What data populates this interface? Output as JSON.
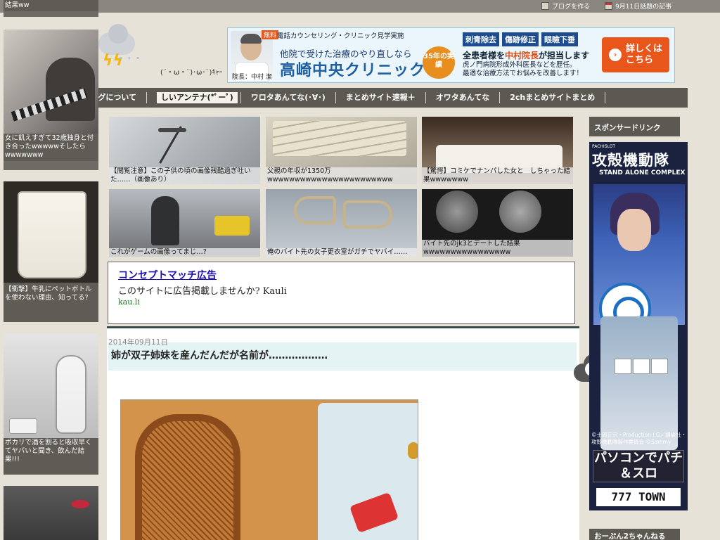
{
  "topbar": {
    "blog_link": "ブログを作る",
    "calendar_link": "9月11日話題の記事"
  },
  "left_column": {
    "top_caption": "結果ww",
    "cards": [
      {
        "caption": "女に飢えすぎて32歳独身と付き合ったwwwwwそしたらwwwwwww"
      },
      {
        "caption": "【衝撃】牛乳にペットボトルを使わない理由、知ってる?"
      },
      {
        "caption": "ポカリで酒を割ると吸収早くてヤバいと聞き、飲んだ結果!!!"
      }
    ]
  },
  "header": {
    "face_text": "(´・ω・`)･ω･`)ｷｬｰ"
  },
  "banner": {
    "free_badge": "無料",
    "top_text": "電話カウンセリング・クリニック見学実施",
    "line1": "他院で受けた治療のやり直しなら",
    "clinic_name": "高崎中央クリニック",
    "director": "院長：中村 潔",
    "years": "35年の実績",
    "tags": [
      "刺青除去",
      "傷跡修正",
      "眼瞼下垂"
    ],
    "line2_pre": "全患者様を",
    "line2_hl": "中村院長",
    "line2_post": "が担当します",
    "line3": "虎ノ門病院形成外科医長などを歴任。",
    "line4": "最適な治療方法でお悩みを改善します！",
    "cta": "詳しくはこちら",
    "accent_color": "#e8561b"
  },
  "nav": {
    "items": [
      {
        "label": "ブログについて"
      },
      {
        "label": "しいアンテナ(*ﾟーﾟ)"
      },
      {
        "label": "ワロタあんてな(･∀･)"
      },
      {
        "label": "まとめサイト速報＋"
      },
      {
        "label": "オワタあんてな"
      },
      {
        "label": "2chまとめサイトまとめ"
      }
    ]
  },
  "thumbnails": [
    {
      "caption": "【閲覧注意】この子供の頃の画像残酷過ぎ吐いた‥‥‥（画像あり）"
    },
    {
      "caption": "父親の年収が1350万wwwwwwwwwwwwwwwwwwwwwww"
    },
    {
      "caption": "【驚愕】コミケでナンパした女と　しちゃった結果wwwwwww"
    },
    {
      "caption": "これがゲームの画像ってまじ…?"
    },
    {
      "caption": "俺のバイト先の女子更衣室がガチでヤバイ‥‥‥"
    },
    {
      "caption": "バイト先のjk3とデートした結果wwwwwwwwwwwwwwww"
    }
  ],
  "ad": {
    "title": "コンセプトマッチ広告",
    "description": "このサイトに広告掲載しませんか? Kauli",
    "url": "kau.li"
  },
  "article": {
    "date": "2014年09月11日",
    "title": "姉が双子姉妹を産んだんだが名前が‥‥‥‥‥‥‥‥‥"
  },
  "right_sidebar": {
    "sponsor_header": "スポンサードリンク",
    "bottom_header": "おーぷん2ちゃんねる",
    "ad": {
      "brand": "PACHISLOT",
      "title": "攻殻機動隊",
      "subtitle": "STAND ALONE COMPLEX",
      "copyright": "©士郎正宗・Production I.G／講談社・攻殻機動隊製作委員会 ©Sammy",
      "pc_text": "パソコンでパチ＆スロ",
      "town": "777 TOWN"
    }
  }
}
